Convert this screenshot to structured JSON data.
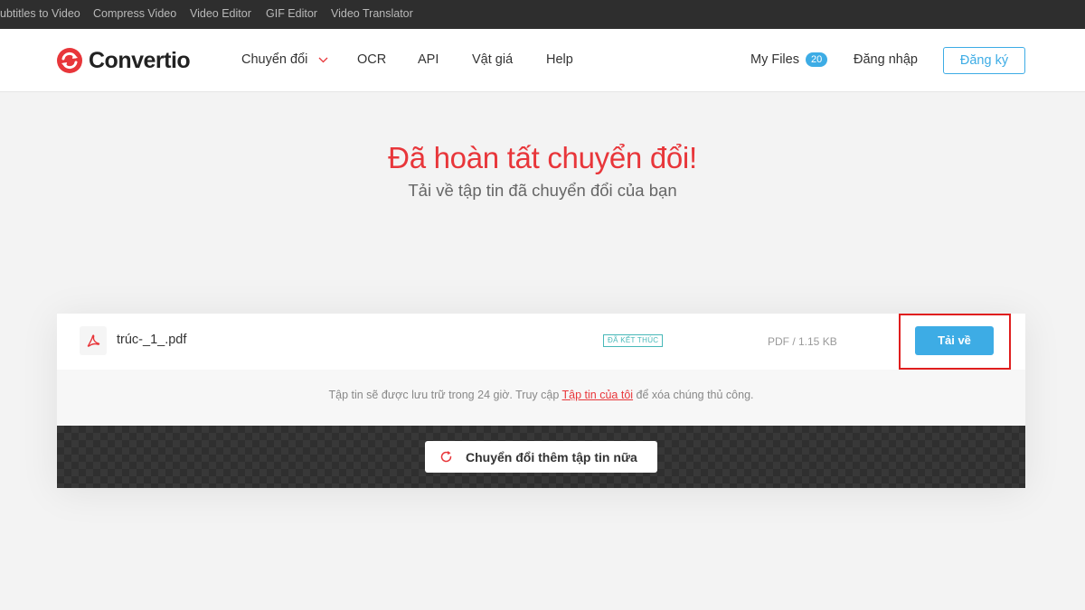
{
  "topbar": {
    "items": [
      "ubtitles to Video",
      "Compress Video",
      "Video Editor",
      "GIF Editor",
      "Video Translator"
    ]
  },
  "header": {
    "logo_text": "Convertio",
    "nav": [
      "Chuyển đổi",
      "OCR",
      "API",
      "Vật giá",
      "Help"
    ],
    "my_files_label": "My Files",
    "my_files_count": "20",
    "login_label": "Đăng nhập",
    "signup_label": "Đăng ký"
  },
  "hero": {
    "title": "Đã hoàn tất chuyển đổi!",
    "subtitle": "Tải về tập tin đã chuyển đổi của bạn"
  },
  "result": {
    "file_name": "trúc-_1_.pdf",
    "status": "ĐÃ KẾT THÚC",
    "size": "PDF / 1.15 KB",
    "download_label": "Tải về"
  },
  "notice": {
    "text_before": "Tập tin sẽ được lưu trữ trong 24 giờ. Truy cập ",
    "link": "Tập tin của tôi",
    "text_after": " để xóa chúng thủ công."
  },
  "convert_more_label": "Chuyển đổi thêm tập tin nữa",
  "colors": {
    "brand_red": "#e8363a",
    "accent_blue": "#3dace5",
    "status_teal": "#47b8b8",
    "highlight_red": "#e01e1e"
  },
  "icons": [
    "convertio-logo-icon",
    "chevron-down-icon",
    "pdf-icon",
    "refresh-icon"
  ]
}
